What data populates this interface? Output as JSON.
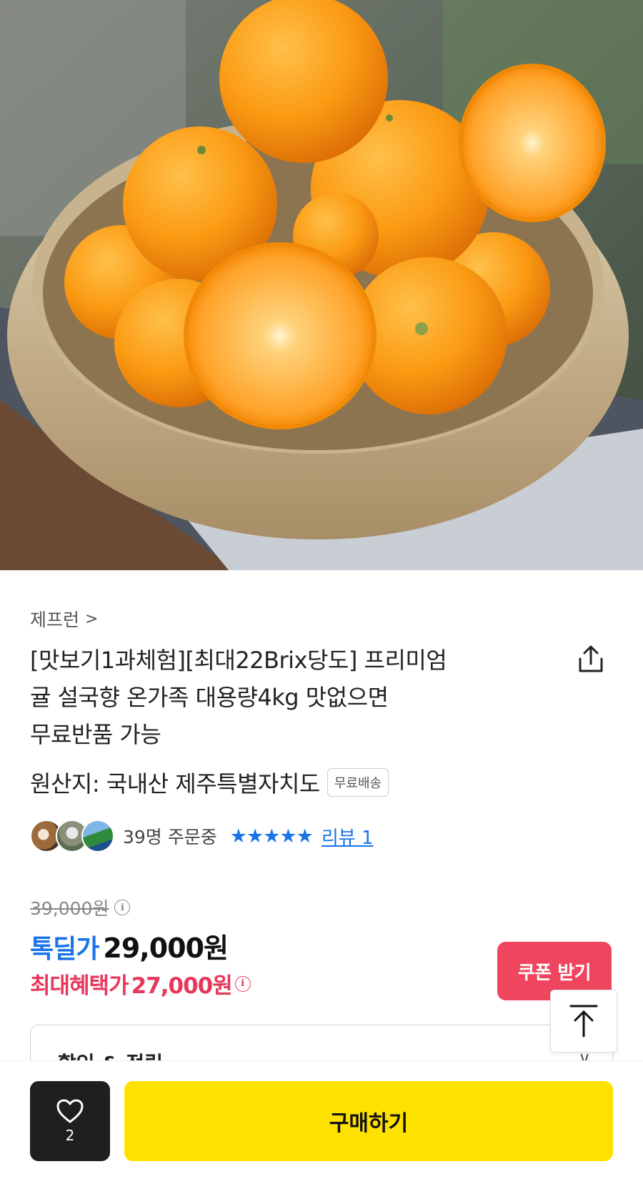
{
  "hero": {
    "image_alt": "tangerines-in-woven-basket"
  },
  "product": {
    "seller": "제프런",
    "title_lines": [
      "[맛보기1과체험][최대22Brix당도] 프리미엄",
      "귤 설국향 온가족 대용량4kg 맛없으면",
      "무료반품 가능"
    ],
    "origin": "원산지: 국내산 제주특별자치도",
    "shipping_badge": "무료배송"
  },
  "social": {
    "orders": "39명 주문중",
    "rating_stars": 5,
    "review_link": "리뷰 1"
  },
  "pricing": {
    "original_price": "39,000원",
    "deal_label": "톡딜가",
    "deal_price": "29,000원",
    "max_benefit_label": "최대혜택가",
    "max_benefit_price": "27,000원",
    "coupon_button": "쿠폰 받기"
  },
  "options": {
    "label": "할인 & 적립"
  },
  "bottom_bar": {
    "like_count": "2",
    "buy_button": "구매하기"
  },
  "colors": {
    "accent_blue": "#1a73e8",
    "accent_red": "#e8375a",
    "coupon_bg": "#f0455e",
    "buy_bg": "#ffe100"
  }
}
